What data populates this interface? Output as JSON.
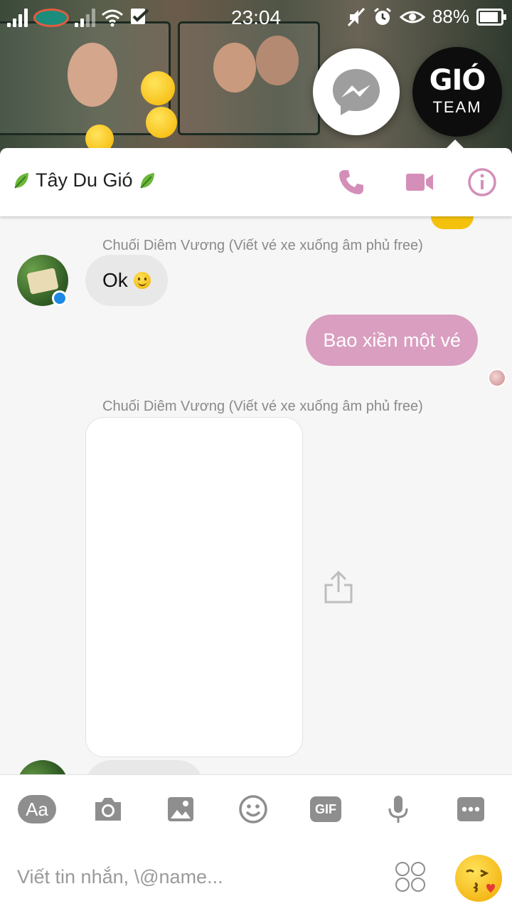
{
  "status_bar": {
    "time": "23:04",
    "battery_percent": "88%",
    "battery_level": 0.88
  },
  "chat_heads": {
    "team_logo": "GIÓ",
    "team_label": "TEAM"
  },
  "header": {
    "title": "Tây Du Gió",
    "icons": [
      "leaf-icon",
      "phone-icon",
      "video-call-icon",
      "info-icon"
    ],
    "accent_color": "#d48fb8"
  },
  "messages": [
    {
      "sender": "Chuối Diêm Vương (Viết vé xe xuống âm phủ free)",
      "text": "Ok",
      "direction": "incoming",
      "emoji": "slightly-smiling-face"
    },
    {
      "text": "Bao xiền một vé",
      "direction": "outgoing",
      "color": "#d99ec0"
    },
    {
      "sender": "Chuối Diêm Vương (Viết vé xe xuống âm phủ free)",
      "type": "media",
      "direction": "incoming"
    }
  ],
  "composer": {
    "aa_label": "Aa",
    "gif_label": "GIF",
    "placeholder": "Viết tin nhắn, \\@name..."
  }
}
